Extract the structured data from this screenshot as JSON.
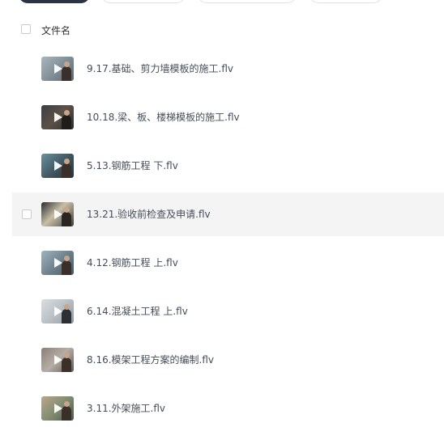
{
  "header": {
    "column_label": "文件名"
  },
  "files": [
    {
      "name": "9.17.基础、剪力墙模板的施工.flv",
      "thumb": "video-thumbnail"
    },
    {
      "name": "10.18.梁、板、楼梯模板的施工.flv",
      "thumb": "video-thumbnail"
    },
    {
      "name": "5.13.钢筋工程 下.flv",
      "thumb": "video-thumbnail"
    },
    {
      "name": "13.21.验收前检查及申请.flv",
      "thumb": "video-thumbnail"
    },
    {
      "name": "4.12.钢筋工程 上.flv",
      "thumb": "video-thumbnail"
    },
    {
      "name": "6.14.混凝土工程 上.flv",
      "thumb": "video-thumbnail"
    },
    {
      "name": "8.16.模架工程方案的编制.flv",
      "thumb": "video-thumbnail"
    },
    {
      "name": "3.11.外架施工.flv",
      "thumb": "video-thumbnail"
    }
  ],
  "colors": {
    "text": "#454d5a",
    "hover_row": "#f4f4f4",
    "primary_button": "#2c3344"
  }
}
